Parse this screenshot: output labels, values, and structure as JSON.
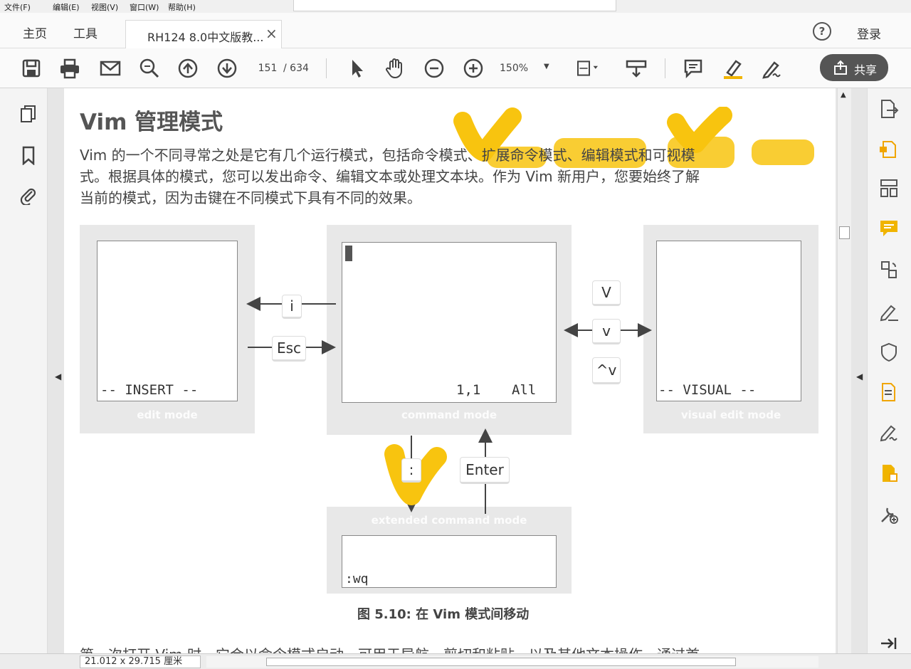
{
  "menubar": {
    "items": [
      "文件(F)",
      "编辑(E)",
      "视图(V)",
      "窗口(W)",
      "帮助(H)"
    ]
  },
  "tabs": {
    "home": "主页",
    "tools": "工具",
    "document": "RH124 8.0中文版教...",
    "close": "×",
    "help": "?",
    "login": "登录"
  },
  "toolbar": {
    "page_current": "151",
    "page_total": "/ 634",
    "zoom": "150%",
    "share": "共享"
  },
  "status": {
    "dimensions": "21.012 x 29.715 厘米"
  },
  "doc": {
    "section_title": "Vim 管理模式",
    "paragraph_lines": [
      "Vim 的一个不同寻常之处是它有几个运行模式，包括命令模式、扩展命令模式、编辑模式和可视模",
      "式。根据具体的模式，您可以发出命令、编辑文本或处理文本块。作为 Vim 新用户，您要始终了解",
      "当前的模式，因为击键在不同模式下具有不同的效果。"
    ],
    "bottom_line": "第一次打开 Vim 时，它会以命令模式启动，可用于导航、剪切和粘贴，以及其他文本操作。通过首",
    "figure": {
      "insert_status": "-- INSERT --",
      "insert_caption": "edit mode",
      "command_position": "1,1",
      "command_all": "All",
      "command_caption": "command mode",
      "visual_status": "-- VISUAL --",
      "visual_caption": "visual edit mode",
      "extended_caption": "extended command mode",
      "extended_prompt": ":wq",
      "key_i": "i",
      "key_esc": "Esc",
      "key_V": "V",
      "key_v": "v",
      "key_ctrl_v": "^v",
      "key_colon": ":",
      "key_enter": "Enter",
      "caption": "图 5.10: 在 Vim 模式间移动"
    }
  },
  "colors": {
    "highlight": "#f8c40f",
    "ui_background": "#fafafa",
    "share_button": "#555555"
  }
}
